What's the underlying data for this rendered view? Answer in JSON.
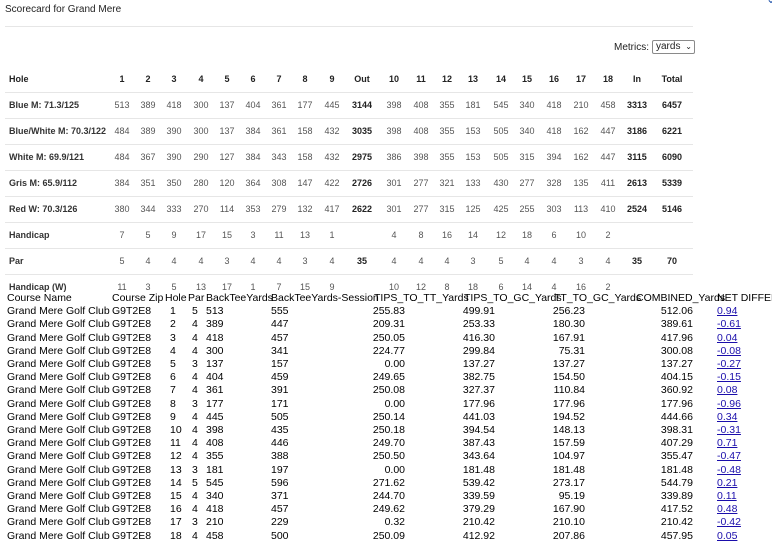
{
  "header": {
    "title": "Scorecard for Grand Mere"
  },
  "metrics": {
    "label": "Metrics:",
    "value": "yards"
  },
  "scorecard": {
    "headers": [
      "Hole",
      "1",
      "2",
      "3",
      "4",
      "5",
      "6",
      "7",
      "8",
      "9",
      "Out",
      "10",
      "11",
      "12",
      "13",
      "14",
      "15",
      "16",
      "17",
      "18",
      "In",
      "Total"
    ],
    "rows": [
      {
        "label": "Blue M: 71.3/125",
        "values": [
          "513",
          "389",
          "418",
          "300",
          "137",
          "404",
          "361",
          "177",
          "445",
          "3144",
          "398",
          "408",
          "355",
          "181",
          "545",
          "340",
          "418",
          "210",
          "458",
          "3313",
          "6457"
        ]
      },
      {
        "label": "Blue/White M: 70.3/122",
        "values": [
          "484",
          "389",
          "390",
          "300",
          "137",
          "384",
          "361",
          "158",
          "432",
          "3035",
          "398",
          "408",
          "355",
          "153",
          "505",
          "340",
          "418",
          "162",
          "447",
          "3186",
          "6221"
        ]
      },
      {
        "label": "White M: 69.9/121",
        "values": [
          "484",
          "367",
          "390",
          "290",
          "127",
          "384",
          "343",
          "158",
          "432",
          "2975",
          "386",
          "398",
          "355",
          "153",
          "505",
          "315",
          "394",
          "162",
          "447",
          "3115",
          "6090"
        ]
      },
      {
        "label": "Gris M: 65.9/112",
        "values": [
          "384",
          "351",
          "350",
          "280",
          "120",
          "364",
          "308",
          "147",
          "422",
          "2726",
          "301",
          "277",
          "321",
          "133",
          "430",
          "277",
          "328",
          "135",
          "411",
          "2613",
          "5339"
        ]
      },
      {
        "label": "Red W: 70.3/126",
        "values": [
          "380",
          "344",
          "333",
          "270",
          "114",
          "353",
          "279",
          "132",
          "417",
          "2622",
          "301",
          "277",
          "315",
          "125",
          "425",
          "255",
          "303",
          "113",
          "410",
          "2524",
          "5146"
        ]
      },
      {
        "label": "Handicap",
        "values": [
          "7",
          "5",
          "9",
          "17",
          "15",
          "3",
          "11",
          "13",
          "1",
          "",
          "4",
          "8",
          "16",
          "14",
          "12",
          "18",
          "6",
          "10",
          "2",
          "",
          ""
        ]
      },
      {
        "label": "Par",
        "values": [
          "5",
          "4",
          "4",
          "4",
          "3",
          "4",
          "4",
          "3",
          "4",
          "35",
          "4",
          "4",
          "4",
          "3",
          "5",
          "4",
          "4",
          "3",
          "4",
          "35",
          "70"
        ]
      },
      {
        "label": "Handicap (W)",
        "values": [
          "11",
          "3",
          "5",
          "13",
          "17",
          "1",
          "7",
          "15",
          "9",
          "",
          "10",
          "12",
          "8",
          "18",
          "6",
          "14",
          "4",
          "16",
          "2",
          "",
          ""
        ]
      }
    ]
  },
  "data_grid": {
    "columns": [
      "Course Name",
      "Course Zip",
      "Hole",
      "Par",
      "BackTeeYards",
      "BackTeeYards-Session",
      "TIPS_TO_TT_Yards",
      "TIPS_TO_GC_Yards",
      "TT_TO_GC_Yards",
      "COMBINED_Yards",
      "NET DIFFERE"
    ],
    "rows": [
      [
        "Grand Mere Golf Club",
        "G9T2E8",
        "1",
        "5",
        "513",
        "555",
        "255.83",
        "499.91",
        "256.23",
        "512.06",
        "0.94"
      ],
      [
        "Grand Mere Golf Club",
        "G9T2E8",
        "2",
        "4",
        "389",
        "447",
        "209.31",
        "253.33",
        "180.30",
        "389.61",
        "-0.61"
      ],
      [
        "Grand Mere Golf Club",
        "G9T2E8",
        "3",
        "4",
        "418",
        "457",
        "250.05",
        "416.30",
        "167.91",
        "417.96",
        "0.04"
      ],
      [
        "Grand Mere Golf Club",
        "G9T2E8",
        "4",
        "4",
        "300",
        "341",
        "224.77",
        "299.84",
        "75.31",
        "300.08",
        "-0.08"
      ],
      [
        "Grand Mere Golf Club",
        "G9T2E8",
        "5",
        "3",
        "137",
        "157",
        "0.00",
        "137.27",
        "137.27",
        "137.27",
        "-0.27"
      ],
      [
        "Grand Mere Golf Club",
        "G9T2E8",
        "6",
        "4",
        "404",
        "459",
        "249.65",
        "382.75",
        "154.50",
        "404.15",
        "-0.15"
      ],
      [
        "Grand Mere Golf Club",
        "G9T2E8",
        "7",
        "4",
        "361",
        "391",
        "250.08",
        "327.37",
        "110.84",
        "360.92",
        "0.08"
      ],
      [
        "Grand Mere Golf Club",
        "G9T2E8",
        "8",
        "3",
        "177",
        "171",
        "0.00",
        "177.96",
        "177.96",
        "177.96",
        "-0.96"
      ],
      [
        "Grand Mere Golf Club",
        "G9T2E8",
        "9",
        "4",
        "445",
        "505",
        "250.14",
        "441.03",
        "194.52",
        "444.66",
        "0.34"
      ],
      [
        "Grand Mere Golf Club",
        "G9T2E8",
        "10",
        "4",
        "398",
        "435",
        "250.18",
        "394.54",
        "148.13",
        "398.31",
        "-0.31"
      ],
      [
        "Grand Mere Golf Club",
        "G9T2E8",
        "11",
        "4",
        "408",
        "446",
        "249.70",
        "387.43",
        "157.59",
        "407.29",
        "0.71"
      ],
      [
        "Grand Mere Golf Club",
        "G9T2E8",
        "12",
        "4",
        "355",
        "388",
        "250.50",
        "343.64",
        "104.97",
        "355.47",
        "-0.47"
      ],
      [
        "Grand Mere Golf Club",
        "G9T2E8",
        "13",
        "3",
        "181",
        "197",
        "0.00",
        "181.48",
        "181.48",
        "181.48",
        "-0.48"
      ],
      [
        "Grand Mere Golf Club",
        "G9T2E8",
        "14",
        "5",
        "545",
        "596",
        "271.62",
        "539.42",
        "273.17",
        "544.79",
        "0.21"
      ],
      [
        "Grand Mere Golf Club",
        "G9T2E8",
        "15",
        "4",
        "340",
        "371",
        "244.70",
        "339.59",
        "95.19",
        "339.89",
        "0.11"
      ],
      [
        "Grand Mere Golf Club",
        "G9T2E8",
        "16",
        "4",
        "418",
        "457",
        "249.62",
        "379.29",
        "167.90",
        "417.52",
        "0.48"
      ],
      [
        "Grand Mere Golf Club",
        "G9T2E8",
        "17",
        "3",
        "210",
        "229",
        "0.32",
        "210.42",
        "210.10",
        "210.42",
        "-0.42"
      ],
      [
        "Grand Mere Golf Club",
        "G9T2E8",
        "18",
        "4",
        "458",
        "500",
        "250.09",
        "412.92",
        "207.86",
        "457.95",
        "0.05"
      ]
    ]
  }
}
